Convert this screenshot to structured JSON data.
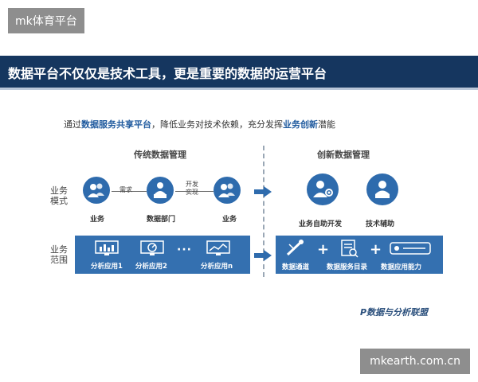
{
  "watermark_top": "mk体育平台",
  "watermark_bottom": "mkearth.com.cn",
  "title": "数据平台不仅仅是技术工具，更是重要的数据的运营平台",
  "subtitle": {
    "part1": "通过",
    "hl1": "数据服务共享平台",
    "part2": "，降低业务对技术依赖，充分发挥",
    "hl2": "业务创新",
    "part3": "潜能"
  },
  "columns": {
    "left": "传统数据管理",
    "right": "创新数据管理"
  },
  "rows": {
    "mode": "业务\n模式",
    "scope": "业务\n范围"
  },
  "traditional": {
    "nodes": [
      "业务",
      "数据部门",
      "业务"
    ],
    "edges": [
      "需求",
      "开发\n实现"
    ],
    "scope_items": [
      "分析应用1",
      "分析应用2",
      "分析应用n"
    ],
    "ellipsis": "···"
  },
  "innovative": {
    "nodes": [
      "业务自助开发",
      "技术辅助"
    ],
    "scope_items": [
      "数据通道",
      "数据服务目录",
      "数据应用能力"
    ],
    "plus": "+"
  },
  "logo_text": "P数据与分析联盟",
  "colors": {
    "navy": "#15365f",
    "blue": "#2e6bad",
    "panel": "#3470b0",
    "highlight": "#1f5a9e"
  }
}
